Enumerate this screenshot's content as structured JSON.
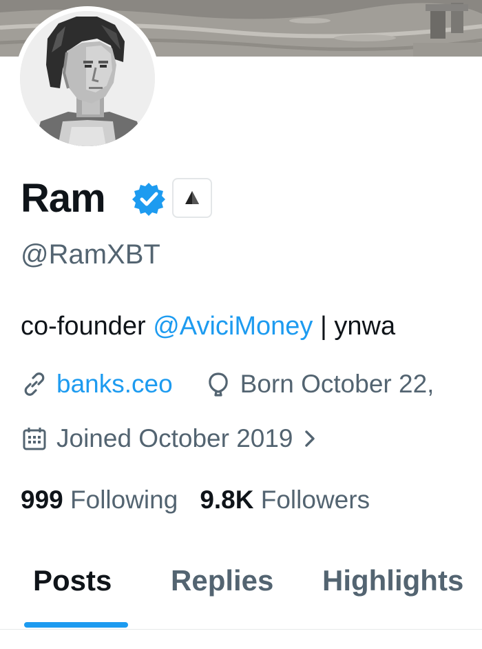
{
  "profile": {
    "display_name": "Ram",
    "handle": "@RamXBT",
    "bio_prefix": "co-founder ",
    "bio_mention": "@AviciMoney",
    "bio_suffix": " | ynwa",
    "website": "banks.ceo",
    "born": "Born October 22,",
    "joined": "Joined October 2019",
    "following_count": "999",
    "following_label": "Following",
    "followers_count": "9.8K",
    "followers_label": "Followers"
  },
  "tabs": [
    {
      "label": "Posts",
      "active": true
    },
    {
      "label": "Replies",
      "active": false
    },
    {
      "label": "Highlights",
      "active": false
    }
  ],
  "icons": {
    "verified": "verified-badge-icon",
    "affiliate": "avici-logo-icon",
    "link": "link-icon",
    "born": "balloon-icon",
    "joined": "calendar-icon",
    "chevron": "chevron-right-icon"
  },
  "colors": {
    "accent": "#1d9bf0",
    "text_primary": "#0f1419",
    "text_secondary": "#536471"
  }
}
